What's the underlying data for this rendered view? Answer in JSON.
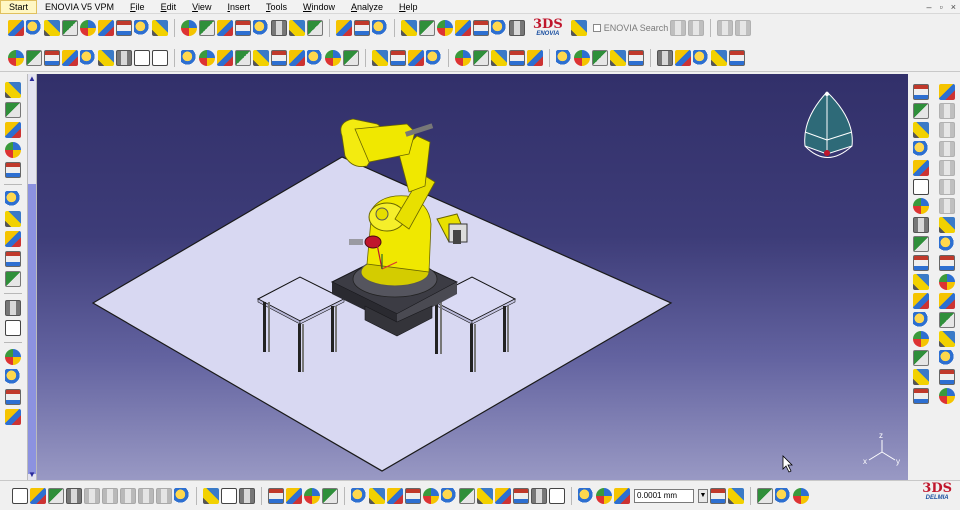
{
  "menubar": {
    "items": [
      {
        "label": "Start",
        "active": true
      },
      {
        "label": "ENOVIA V5 VPM"
      },
      {
        "label": "File"
      },
      {
        "label": "Edit"
      },
      {
        "label": "View"
      },
      {
        "label": "Insert"
      },
      {
        "label": "Tools"
      },
      {
        "label": "Window"
      },
      {
        "label": "Analyze"
      },
      {
        "label": "Help"
      }
    ],
    "window_controls": [
      "–",
      "▫",
      "×"
    ]
  },
  "toolbar1": {
    "enovia_logo_text": "ENOVIA",
    "enovia_search_label": "ENOVIA Search"
  },
  "bottom_toolbar": {
    "units_value": "0.0001 mm"
  },
  "brand": {
    "delmia_logo_text": "DELMIA",
    "logo_mark": "3DS"
  },
  "compass": {
    "axis_labels": {
      "x": "x",
      "y": "y",
      "z": "z"
    }
  },
  "colors": {
    "viewport_top": "#32306a",
    "viewport_bottom": "#9999c4",
    "floor": "#d8d8f2",
    "robot_yellow": "#f0e800",
    "robot_base": "#3c3c44",
    "accent_red": "#c0162c"
  }
}
